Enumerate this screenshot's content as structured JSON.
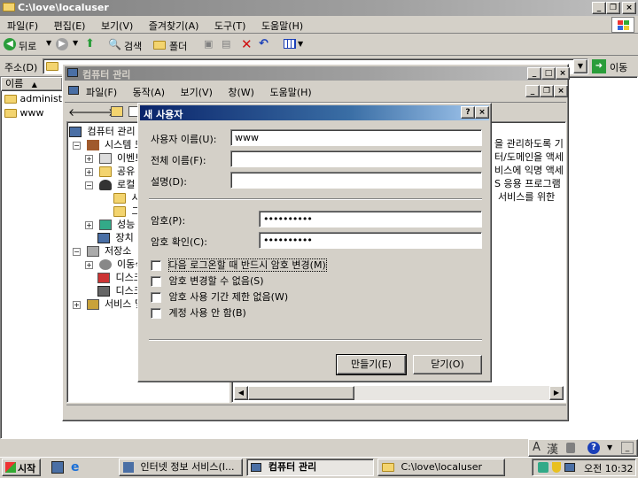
{
  "explorer": {
    "title": "C:\\love\\localuser",
    "menu": [
      "파일(F)",
      "편집(E)",
      "보기(V)",
      "즐겨찾기(A)",
      "도구(T)",
      "도움말(H)"
    ],
    "toolbar": {
      "back": "뒤로",
      "search": "검색",
      "folders": "폴더"
    },
    "address_label": "주소(D)",
    "go_label": "이동",
    "column_name": "이름",
    "files": [
      "administr",
      "www"
    ]
  },
  "mmc": {
    "title": "컴퓨터 관리",
    "menu": [
      "파일(F)",
      "동작(A)",
      "보기(V)",
      "창(W)",
      "도움말(H)"
    ],
    "tree": {
      "root": "컴퓨터 관리",
      "system_tools": "시스템 도",
      "event_viewer": "이벤트",
      "shared": "공유",
      "local": "로컬",
      "local_sub1": "시",
      "local_sub2": "그",
      "perf": "성능",
      "device": "장치",
      "storage": "저장소",
      "removable": "이동식",
      "disk1": "디스크",
      "disk2": "디스크",
      "services": "서비스 및"
    },
    "right_lines": [
      "을 관리하도록 기",
      "터/도메인을 액세",
      "비스에 익명 액세",
      "S 응용 프로그램",
      "서비스를 위한"
    ]
  },
  "dialog": {
    "title": "새 사용자",
    "help": "?",
    "close": "×",
    "username_label": "사용자 이름(U):",
    "username_value": "www",
    "fullname_label": "전체 이름(F):",
    "fullname_value": "",
    "description_label": "설명(D):",
    "description_value": "",
    "password_label": "암호(P):",
    "password_value": "••••••••••",
    "confirm_label": "암호 확인(C):",
    "confirm_value": "••••••••••",
    "checkboxes": [
      {
        "label": "다음 로그온할 때 반드시 암호 변경(M)",
        "checked": false
      },
      {
        "label": "암호 변경할 수 없음(S)",
        "checked": false
      },
      {
        "label": "암호 사용 기간 제한 없음(W)",
        "checked": false
      },
      {
        "label": "계정 사용 안 함(B)",
        "checked": false
      }
    ],
    "create_button": "만들기(E)",
    "close_button": "닫기(O)"
  },
  "langbar": {
    "mode": "A",
    "hanja": "漢"
  },
  "taskbar": {
    "start": "시작",
    "tasks": [
      "인터넷 정보 서비스(I...",
      "컴퓨터 관리",
      "C:\\love\\localuser"
    ],
    "clock": "오전 10:32"
  }
}
